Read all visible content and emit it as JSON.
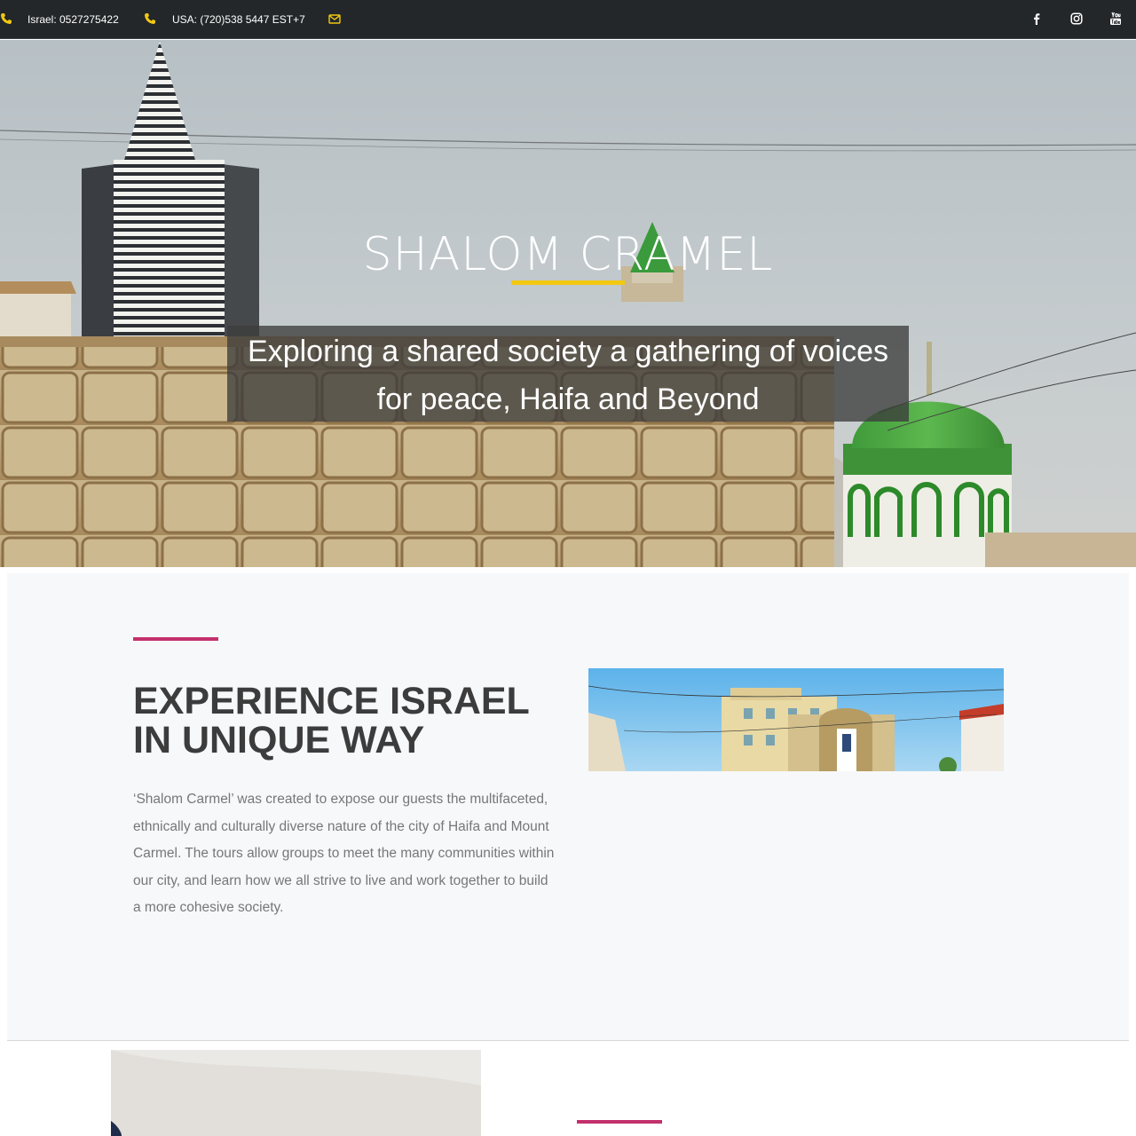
{
  "topbar": {
    "phone_israel": "Israel: 0527275422",
    "phone_usa": "USA: (720)538 5447 EST+7",
    "icons": [
      "phone-icon",
      "phone-icon",
      "envelope-icon",
      "facebook-icon",
      "instagram-icon",
      "youtube-icon"
    ],
    "icon_color": "#f2c811"
  },
  "hero": {
    "title": "SHALOM CRAMEL",
    "subtitle": "Exploring a shared society a gathering of voices for peace, Haifa and Beyond",
    "accent_color": "#f2c811"
  },
  "about": {
    "title": "EXPERIENCE ISRAEL IN UNIQUE WAY",
    "text": "‘Shalom Carmel’ was created to expose our guests the multifaceted, ethnically and culturally diverse nature of the city of Haifa and Mount Carmel. The tours allow groups to meet the many communities within our city, and learn how we all strive to live and work together to build a more cohesive society.",
    "accent_color": "#c2306c"
  }
}
